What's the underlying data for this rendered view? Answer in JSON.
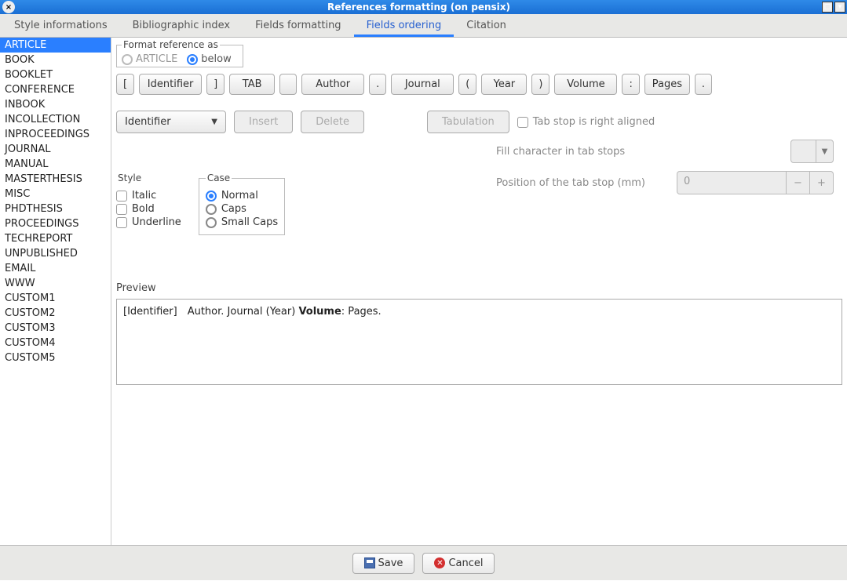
{
  "window": {
    "title": "References formatting (on pensix)"
  },
  "tabs": [
    {
      "label": "Style informations",
      "active": false
    },
    {
      "label": "Bibliographic index",
      "active": false
    },
    {
      "label": "Fields formatting",
      "active": false
    },
    {
      "label": "Fields ordering",
      "active": true
    },
    {
      "label": "Citation",
      "active": false
    }
  ],
  "sidebar": {
    "items": [
      "ARTICLE",
      "BOOK",
      "BOOKLET",
      "CONFERENCE",
      "INBOOK",
      "INCOLLECTION",
      "INPROCEEDINGS",
      "JOURNAL",
      "MANUAL",
      "MASTERTHESIS",
      "MISC",
      "PHDTHESIS",
      "PROCEEDINGS",
      "TECHREPORT",
      "UNPUBLISHED",
      "EMAIL",
      "WWW",
      "CUSTOM1",
      "CUSTOM2",
      "CUSTOM3",
      "CUSTOM4",
      "CUSTOM5"
    ],
    "selected": "ARTICLE"
  },
  "format_as": {
    "legend": "Format reference as",
    "option_article": "ARTICLE",
    "option_below": "below",
    "selected": "below"
  },
  "tokens": [
    "[",
    "Identifier",
    "]",
    "TAB",
    "",
    "Author",
    ".",
    "Journal",
    "(",
    "Year",
    ")",
    "Volume",
    ":",
    "Pages",
    "."
  ],
  "combo": {
    "value": "Identifier"
  },
  "buttons": {
    "insert": "Insert",
    "delete": "Delete",
    "tabulation": "Tabulation"
  },
  "tab_opts": {
    "right_aligned_label": "Tab stop is right aligned",
    "fill_char_label": "Fill character in tab stops",
    "position_label": "Position of the tab stop (mm)",
    "position_value": "0"
  },
  "style_group": {
    "legend": "Style",
    "italic": "Italic",
    "bold": "Bold",
    "underline": "Underline"
  },
  "case_group": {
    "legend": "Case",
    "normal": "Normal",
    "caps": "Caps",
    "small_caps": "Small Caps",
    "selected": "Normal"
  },
  "preview": {
    "label": "Preview",
    "text_before": "[Identifier] Author. Journal (Year) ",
    "text_bold": "Volume",
    "text_after": ": Pages."
  },
  "footer": {
    "save": "Save",
    "cancel": "Cancel"
  }
}
